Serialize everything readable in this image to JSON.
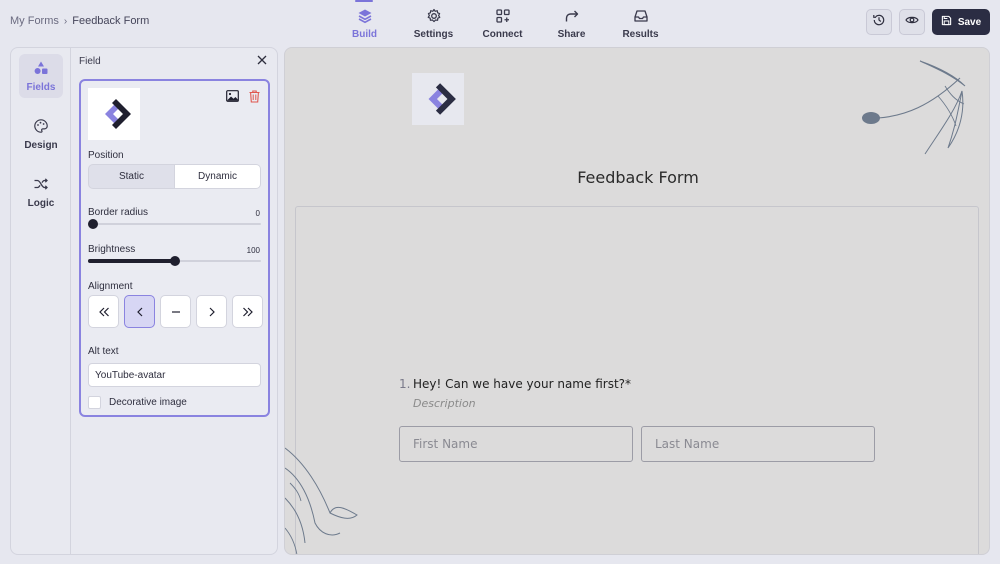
{
  "breadcrumb": {
    "parent": "My Forms",
    "separator": "›",
    "current": "Feedback Form"
  },
  "nav": {
    "tabs": [
      {
        "label": "Build",
        "icon": "layers-icon",
        "active": true
      },
      {
        "label": "Settings",
        "icon": "gear-icon"
      },
      {
        "label": "Connect",
        "icon": "grid-plus-icon"
      },
      {
        "label": "Share",
        "icon": "share-arrow-icon"
      },
      {
        "label": "Results",
        "icon": "inbox-icon"
      }
    ]
  },
  "actions": {
    "save_label": "Save"
  },
  "rail": {
    "items": [
      {
        "label": "Fields",
        "icon": "shapes-icon",
        "active": true
      },
      {
        "label": "Design",
        "icon": "palette-icon"
      },
      {
        "label": "Logic",
        "icon": "shuffle-icon"
      }
    ]
  },
  "panel": {
    "title": "Field",
    "position_label": "Position",
    "position_options": [
      "Static",
      "Dynamic"
    ],
    "position_selected": "Dynamic",
    "border_radius_label": "Border radius",
    "border_radius_value": "0",
    "brightness_label": "Brightness",
    "brightness_value": "100",
    "brightness_fraction": 0.5,
    "alignment_label": "Alignment",
    "alignment_selected": "left",
    "alt_text_label": "Alt text",
    "alt_text_value": "YouTube-avatar",
    "decorative_label": "Decorative image",
    "decorative_checked": false
  },
  "form": {
    "title": "Feedback Form",
    "question_number": "1.",
    "question_text": "Hey! Can we have your name first?*",
    "question_description": "Description",
    "first_name_placeholder": "First Name",
    "last_name_placeholder": "Last Name"
  },
  "colors": {
    "accent": "#7b74d9",
    "dark": "#2b2d43",
    "canvas": "#dcdbdb"
  }
}
